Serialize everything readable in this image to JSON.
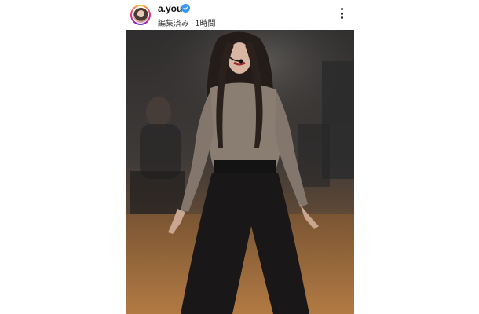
{
  "post": {
    "username": "a.you",
    "edited_label": "編集済み",
    "separator": "·",
    "time_ago": "1時間",
    "verified": true,
    "verified_color": "#3897f0",
    "avatar_ring_colors": [
      "#f9ce34",
      "#ee2a7b",
      "#6228d7"
    ],
    "more_icon": "more-vertical-icon"
  },
  "photo": {
    "subject": "dancer-photo"
  }
}
